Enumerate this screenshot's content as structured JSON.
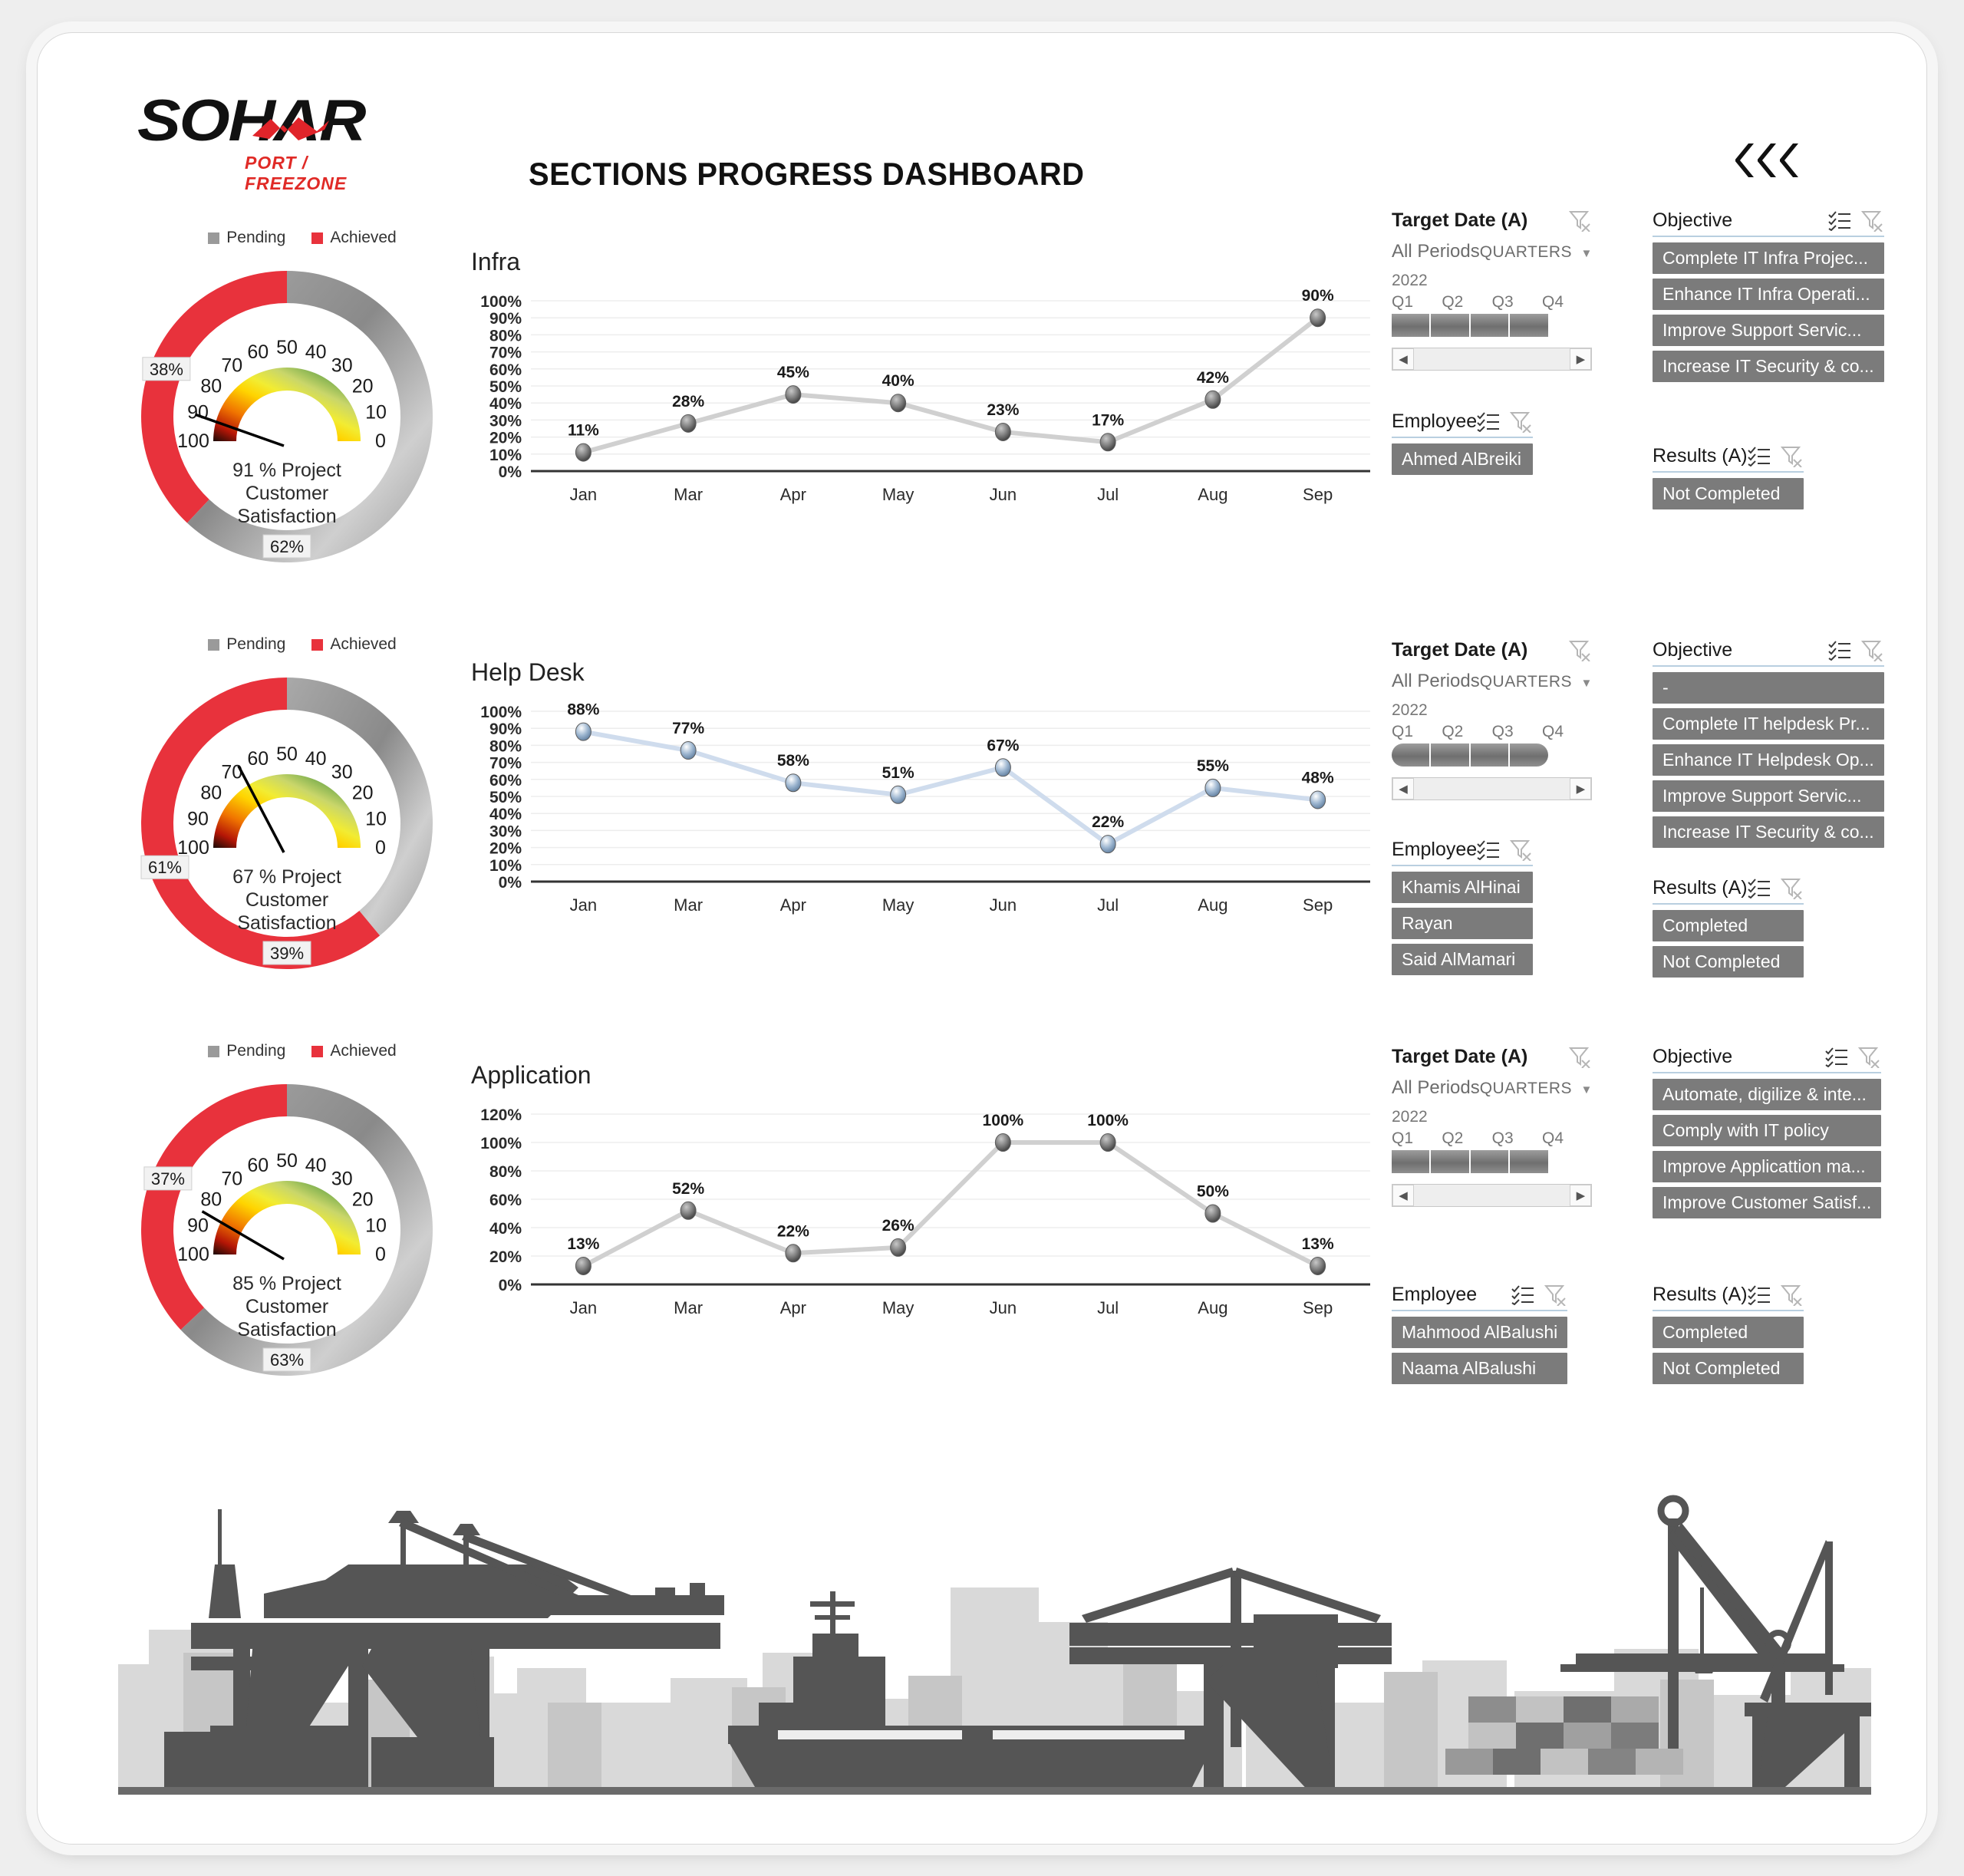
{
  "header": {
    "logo_main": "SOHAR",
    "logo_sub": "PORT / FREEZONE",
    "title": "SECTIONS PROGRESS DASHBOARD",
    "collapse_icon": "chevron-left-triple-icon"
  },
  "legend": {
    "pending": "Pending",
    "achieved": "Achieved"
  },
  "colors": {
    "achieved_red": "#e8323c",
    "pending_gray": "#9a9a9a",
    "slicer_item_bg": "#7b7b7b",
    "brand_red": "#e02a26",
    "helpdesk_line": "#cfdced"
  },
  "sections": [
    {
      "name": "Infra",
      "gauge": {
        "achieved_pct": "38%",
        "pending_pct": "62%",
        "achieved_value": 38,
        "needle_value": 91,
        "center_line1": "91 % Project",
        "center_line2": "Customer",
        "center_line3": "Satisfaction",
        "scale_labels": [
          "0",
          "10",
          "20",
          "30",
          "40",
          "50",
          "60",
          "70",
          "80",
          "90",
          "100"
        ]
      },
      "slicers": {
        "target_date": {
          "title": "Target Date (A)",
          "all_periods": "All Periods",
          "granularity": "QUARTERS",
          "year": "2022",
          "quarters": [
            "Q1",
            "Q2",
            "Q3",
            "Q4"
          ],
          "rounded": false
        },
        "objective": {
          "title": "Objective",
          "items": [
            "Complete IT Infra Projec...",
            "Enhance IT Infra Operati...",
            "Improve  Support Servic...",
            "Increase IT Security & co..."
          ]
        },
        "employee": {
          "title": "Employee",
          "items": [
            "Ahmed AlBreiki"
          ]
        },
        "results": {
          "title": "Results (A)",
          "items": [
            "Not Completed"
          ]
        }
      }
    },
    {
      "name": "Help Desk",
      "gauge": {
        "achieved_pct": "61%",
        "pending_pct": "39%",
        "achieved_value": 61,
        "needle_value": 67,
        "center_line1": "67 % Project",
        "center_line2": "Customer",
        "center_line3": "Satisfaction",
        "scale_labels": [
          "0",
          "10",
          "20",
          "30",
          "40",
          "50",
          "60",
          "70",
          "80",
          "90",
          "100"
        ]
      },
      "slicers": {
        "target_date": {
          "title": "Target Date (A)",
          "all_periods": "All Periods",
          "granularity": "QUARTERS",
          "year": "2022",
          "quarters": [
            "Q1",
            "Q2",
            "Q3",
            "Q4"
          ],
          "rounded": true
        },
        "objective": {
          "title": "Objective",
          "items": [
            "-",
            "Complete IT helpdesk Pr...",
            "Enhance IT Helpdesk Op...",
            "Improve  Support Servic...",
            "Increase IT Security & co..."
          ]
        },
        "employee": {
          "title": "Employee",
          "items": [
            "Khamis AlHinai",
            "Rayan",
            "Said AlMamari"
          ]
        },
        "results": {
          "title": "Results (A)",
          "items": [
            "Completed",
            "Not Completed"
          ]
        }
      }
    },
    {
      "name": "Application",
      "gauge": {
        "achieved_pct": "37%",
        "pending_pct": "63%",
        "achieved_value": 37,
        "needle_value": 85,
        "center_line1": "85 % Project",
        "center_line2": "Customer",
        "center_line3": "Satisfaction",
        "scale_labels": [
          "0",
          "10",
          "20",
          "30",
          "40",
          "50",
          "60",
          "70",
          "80",
          "90",
          "100"
        ]
      },
      "slicers": {
        "target_date": {
          "title": "Target Date (A)",
          "all_periods": "All Periods",
          "granularity": "QUARTERS",
          "year": "2022",
          "quarters": [
            "Q1",
            "Q2",
            "Q3",
            "Q4"
          ],
          "rounded": false
        },
        "objective": {
          "title": "Objective",
          "items": [
            "Automate, digilize & inte...",
            "Comply with IT policy",
            "Improve Applicattion ma...",
            "Improve Customer Satisf..."
          ]
        },
        "employee": {
          "title": "Employee",
          "items": [
            "Mahmood AlBalushi",
            "Naama AlBalushi"
          ]
        },
        "results": {
          "title": "Results (A)",
          "items": [
            "Completed",
            "Not Completed"
          ]
        }
      }
    }
  ],
  "chart_data": [
    {
      "type": "line",
      "title": "Infra",
      "categories": [
        "Jan",
        "Mar",
        "Apr",
        "May",
        "Jun",
        "Jul",
        "Aug",
        "Sep"
      ],
      "values": [
        11,
        28,
        45,
        40,
        23,
        17,
        42,
        90
      ],
      "labels": [
        "11%",
        "28%",
        "45%",
        "40%",
        "23%",
        "17%",
        "42%",
        "90%"
      ],
      "ylim": [
        0,
        100
      ],
      "ystep": 10,
      "yticks": [
        "0%",
        "10%",
        "20%",
        "30%",
        "40%",
        "50%",
        "60%",
        "70%",
        "80%",
        "90%",
        "100%"
      ],
      "xlabel": "",
      "ylabel": "",
      "grid": true,
      "legend": "none",
      "series_color": "#d0d0d0"
    },
    {
      "type": "line",
      "title": "Help Desk",
      "categories": [
        "Jan",
        "Mar",
        "Apr",
        "May",
        "Jun",
        "Jul",
        "Aug",
        "Sep"
      ],
      "values": [
        88,
        77,
        58,
        51,
        67,
        22,
        55,
        48
      ],
      "labels": [
        "88%",
        "77%",
        "58%",
        "51%",
        "67%",
        "22%",
        "55%",
        "48%"
      ],
      "ylim": [
        0,
        100
      ],
      "ystep": 10,
      "yticks": [
        "0%",
        "10%",
        "20%",
        "30%",
        "40%",
        "50%",
        "60%",
        "70%",
        "80%",
        "90%",
        "100%"
      ],
      "xlabel": "",
      "ylabel": "",
      "grid": true,
      "legend": "none",
      "series_color": "#cfdced"
    },
    {
      "type": "line",
      "title": "Application",
      "categories": [
        "Jan",
        "Mar",
        "Apr",
        "May",
        "Jun",
        "Jul",
        "Aug",
        "Sep"
      ],
      "values": [
        13,
        52,
        22,
        26,
        100,
        100,
        50,
        13
      ],
      "labels": [
        "13%",
        "52%",
        "22%",
        "26%",
        "100%",
        "100%",
        "50%",
        "13%"
      ],
      "ylim": [
        0,
        120
      ],
      "ystep": 20,
      "yticks": [
        "0%",
        "20%",
        "40%",
        "60%",
        "80%",
        "100%",
        "120%"
      ],
      "xlabel": "",
      "ylabel": "",
      "grid": true,
      "legend": "none",
      "series_color": "#d0d0d0"
    }
  ]
}
